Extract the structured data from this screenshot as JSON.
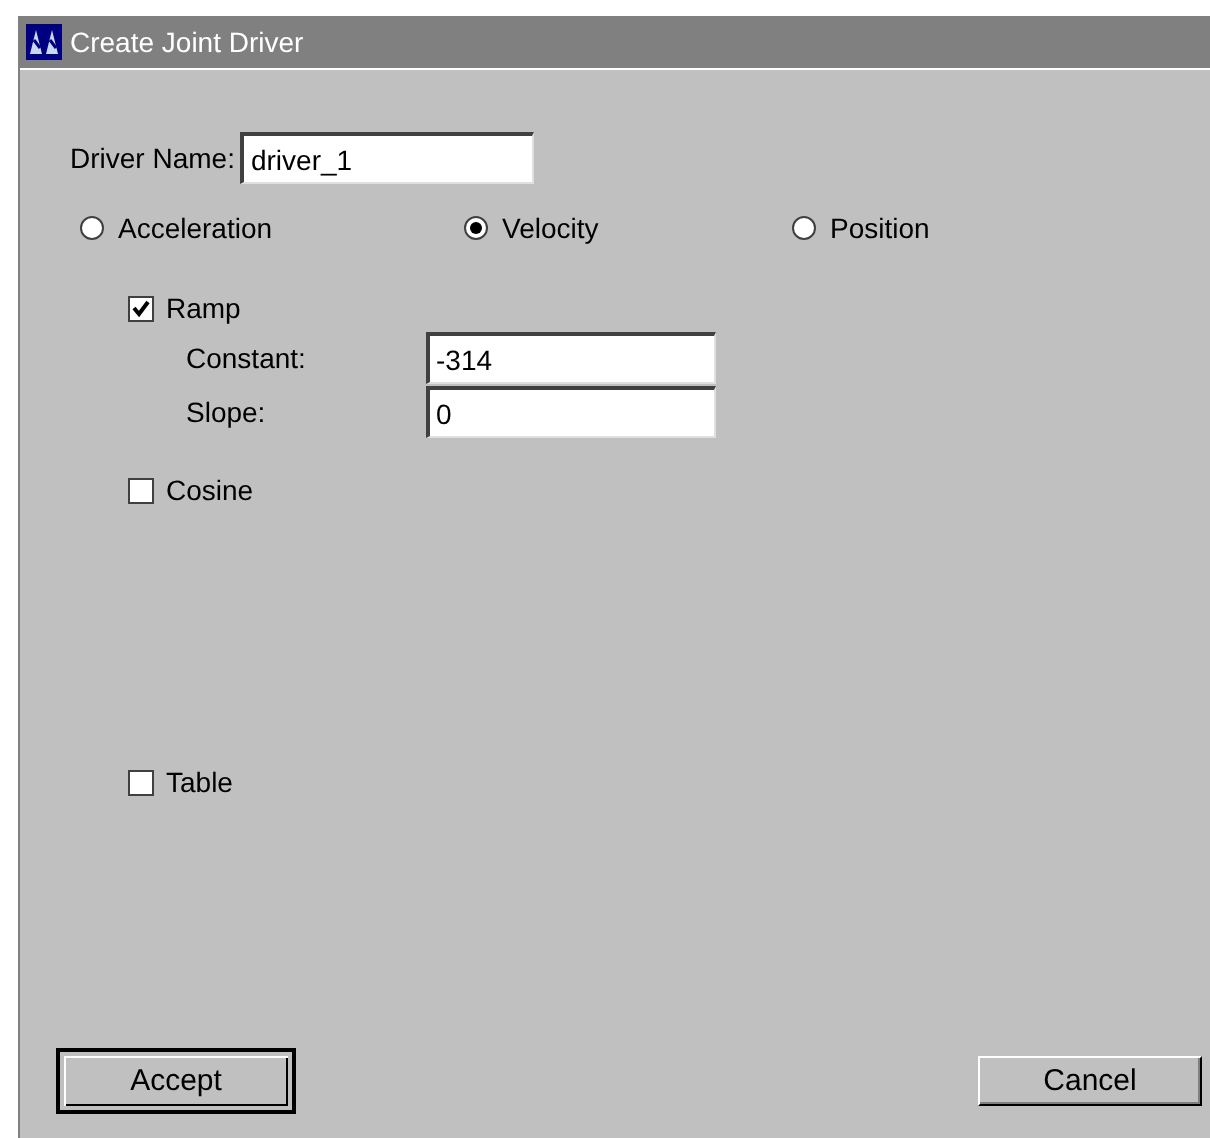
{
  "window": {
    "title": "Create Joint Driver"
  },
  "driver_name": {
    "label": "Driver Name:",
    "value": "driver_1"
  },
  "modes": [
    {
      "label": "Acceleration",
      "selected": false
    },
    {
      "label": "Velocity",
      "selected": true
    },
    {
      "label": "Position",
      "selected": false
    }
  ],
  "functions": [
    {
      "label": "Ramp",
      "checked": true,
      "params": [
        {
          "label": "Constant:",
          "value": "-314"
        },
        {
          "label": "Slope:",
          "value": "0"
        }
      ]
    },
    {
      "label": "Cosine",
      "checked": false
    },
    {
      "label": "Table",
      "checked": false
    }
  ],
  "buttons": [
    {
      "label": "Accept",
      "default": true
    },
    {
      "label": "Cancel",
      "default": false
    }
  ]
}
